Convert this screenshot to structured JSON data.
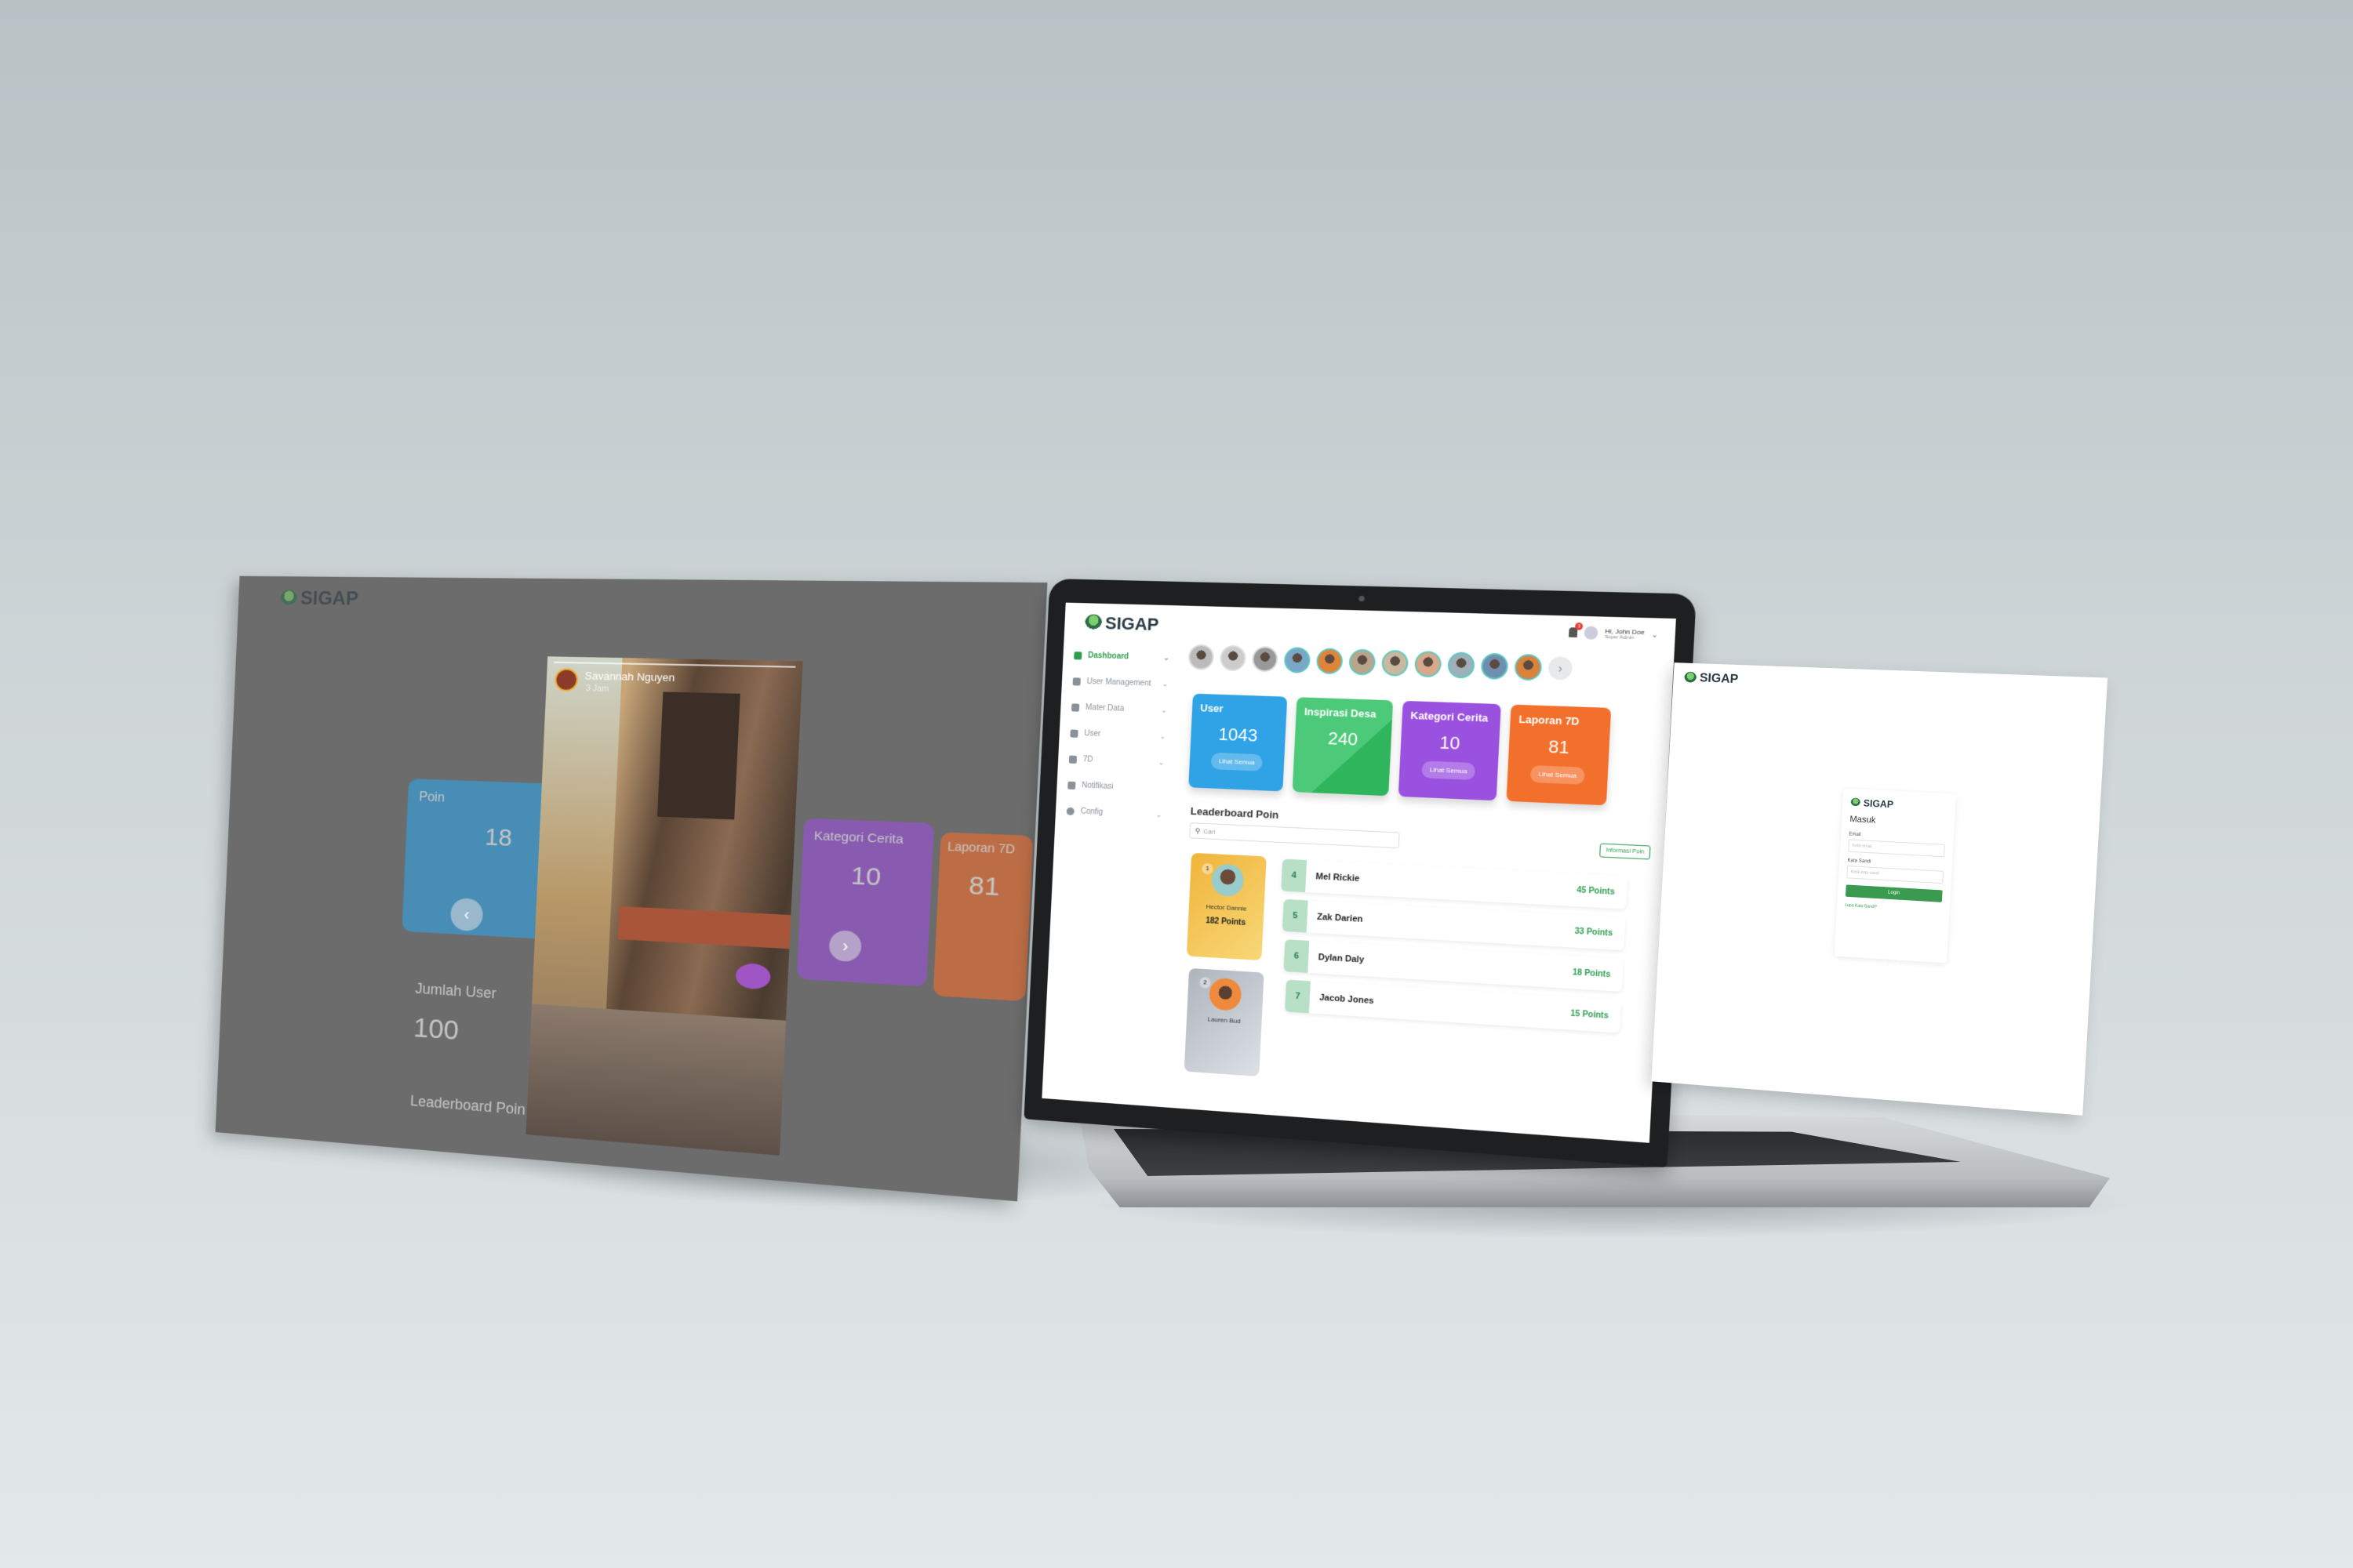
{
  "brand": "SIGAP",
  "colors": {
    "accent": "#2f9e4f",
    "user_card": "#2fa3e6",
    "inspirasi_card": "#3cc46a",
    "kategori_card": "#9b51e0",
    "laporan_card": "#f36f2c",
    "first_place": "#f3c24c",
    "second_place": "#c3c8cf"
  },
  "sidebar": {
    "items": [
      {
        "label": "Dashboard",
        "icon": "home-icon",
        "active": true,
        "has_chevron": true
      },
      {
        "label": "User Management",
        "icon": "users-icon",
        "has_chevron": true
      },
      {
        "label": "Mater Data",
        "icon": "folder-icon",
        "has_chevron": true
      },
      {
        "label": "User",
        "icon": "user-icon",
        "has_chevron": true
      },
      {
        "label": "7D",
        "icon": "document-icon",
        "has_chevron": true
      },
      {
        "label": "Notifikasi",
        "icon": "bell-icon",
        "has_chevron": false
      },
      {
        "label": "Config",
        "icon": "gear-icon",
        "has_chevron": true
      }
    ]
  },
  "header": {
    "greeting": "Hi, John Doe",
    "role": "Super Admin",
    "notification_count": "3"
  },
  "stories": {
    "count": 11,
    "next_icon": "chevron-right-icon"
  },
  "cards": [
    {
      "title": "User",
      "value": "1043",
      "button": "Lihat Semua"
    },
    {
      "title": "Inspirasi Desa",
      "value": "240",
      "button": ""
    },
    {
      "title": "Kategori Cerita",
      "value": "10",
      "button": "Lihat Semua"
    },
    {
      "title": "Laporan 7D",
      "value": "81",
      "button": "Lihat Semua"
    }
  ],
  "leaderboard": {
    "title": "Leaderboard Poin",
    "search_placeholder": "Cari",
    "info_button": "Informasi Poin",
    "top": [
      {
        "rank": "1",
        "name": "Hector Dannie",
        "points": "182 Points"
      },
      {
        "rank": "2",
        "name": "Lauren Bud",
        "points": ""
      }
    ],
    "rows": [
      {
        "rank": "4",
        "name": "Mel Rickie",
        "points": "45 Points"
      },
      {
        "rank": "5",
        "name": "Zak Darien",
        "points": "33 Points"
      },
      {
        "rank": "6",
        "name": "Dylan Daly",
        "points": "18 Points"
      },
      {
        "rank": "7",
        "name": "Jacob Jones",
        "points": "15 Points"
      }
    ]
  },
  "story_view": {
    "author": "Savannah Nguyen",
    "time": "3 Jam",
    "prev_icon": "chevron-left-icon",
    "next_icon": "chevron-right-icon",
    "bg_cards": [
      {
        "title": "Poin",
        "value": "18"
      },
      {
        "title": "Kategori Cerita",
        "value": "10"
      },
      {
        "title": "Laporan 7D",
        "value": "81"
      }
    ],
    "jumlah_user_label": "Jumlah User",
    "jumlah_user_value": "100"
  },
  "login": {
    "title": "Masuk",
    "email_label": "Email",
    "email_placeholder": "Ketik email",
    "password_label": "Kata Sandi",
    "password_placeholder": "Ketik kata sandi",
    "login_button": "Login",
    "forgot_link": "Lupa Kata Sandi?"
  }
}
